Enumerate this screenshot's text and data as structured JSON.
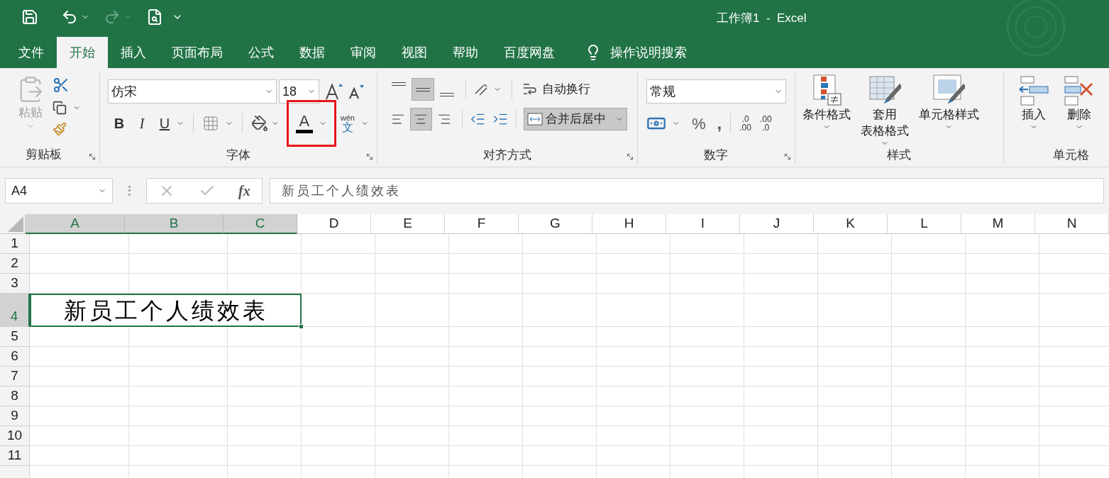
{
  "window": {
    "title": "工作簿1  -  Excel"
  },
  "quick_access": [
    {
      "kind": "save",
      "disabled": false
    },
    {
      "kind": "undo",
      "disabled": false
    },
    {
      "kind": "redo",
      "disabled": true
    },
    {
      "kind": "preview",
      "disabled": false
    },
    {
      "kind": "customize",
      "disabled": false
    }
  ],
  "tabs": [
    {
      "label": "文件",
      "selected": false
    },
    {
      "label": "开始",
      "selected": true
    },
    {
      "label": "插入",
      "selected": false
    },
    {
      "label": "页面布局",
      "selected": false
    },
    {
      "label": "公式",
      "selected": false
    },
    {
      "label": "数据",
      "selected": false
    },
    {
      "label": "审阅",
      "selected": false
    },
    {
      "label": "视图",
      "selected": false
    },
    {
      "label": "帮助",
      "selected": false
    },
    {
      "label": "百度网盘",
      "selected": false
    }
  ],
  "tell_me": "操作说明搜索",
  "clipboard": {
    "label": "剪贴板",
    "paste": "粘贴"
  },
  "font": {
    "label": "字体",
    "font_name": "仿宋",
    "font_size": "18",
    "bold": "B",
    "italic": "I",
    "underline": "U",
    "phonetic_top": "wén",
    "phonetic_bottom": "文",
    "font_color": {
      "letter": "A",
      "highlighted": true
    }
  },
  "alignment": {
    "label": "对齐方式",
    "vertical": [
      {
        "selected": false
      },
      {
        "selected": true
      },
      {
        "selected": false
      }
    ],
    "horizontal": [
      {
        "selected": false
      },
      {
        "selected": true
      },
      {
        "selected": false
      }
    ],
    "wrap_text": "自动换行",
    "merge_center": {
      "label": "合并后居中",
      "selected": true
    }
  },
  "number": {
    "label": "数字",
    "format": "常规",
    "percent": "%",
    "comma": ",",
    "decimals": [
      {
        "top": ".0",
        "bottom": ".00"
      },
      {
        "top": ".00",
        "bottom": ".0"
      }
    ]
  },
  "styles": {
    "label": "样式",
    "buttons": [
      {
        "kind": "conditional",
        "lines": [
          "条件格式"
        ]
      },
      {
        "kind": "table",
        "lines": [
          "套用",
          "表格格式"
        ]
      },
      {
        "kind": "cell",
        "lines": [
          "单元格样式"
        ]
      }
    ]
  },
  "cells": {
    "label": "单元格",
    "buttons": [
      {
        "kind": "insert",
        "label": "插入"
      },
      {
        "kind": "delete",
        "label": "删除"
      }
    ]
  },
  "formula_bar": {
    "name_box": "A4",
    "fx": "fx",
    "content": "新员工个人绩效表"
  },
  "sheet": {
    "columns": [
      {
        "label": "A",
        "selected": true
      },
      {
        "label": "B",
        "selected": true
      },
      {
        "label": "C",
        "selected": true
      },
      {
        "label": "D",
        "selected": false
      },
      {
        "label": "E",
        "selected": false
      },
      {
        "label": "F",
        "selected": false
      },
      {
        "label": "G",
        "selected": false
      },
      {
        "label": "H",
        "selected": false
      },
      {
        "label": "I",
        "selected": false
      },
      {
        "label": "J",
        "selected": false
      },
      {
        "label": "K",
        "selected": false
      },
      {
        "label": "L",
        "selected": false
      },
      {
        "label": "M",
        "selected": false
      },
      {
        "label": "N",
        "selected": false
      }
    ],
    "rows": [
      {
        "label": "1",
        "selected": false,
        "kind": "normal"
      },
      {
        "label": "2",
        "selected": false,
        "kind": "normal"
      },
      {
        "label": "3",
        "selected": false,
        "kind": "normal"
      },
      {
        "label": "4",
        "selected": true,
        "kind": "merged",
        "value": "新员工个人绩效表"
      },
      {
        "label": "5",
        "selected": false,
        "kind": "normal"
      },
      {
        "label": "6",
        "selected": false,
        "kind": "normal"
      },
      {
        "label": "7",
        "selected": false,
        "kind": "normal"
      },
      {
        "label": "8",
        "selected": false,
        "kind": "normal"
      },
      {
        "label": "9",
        "selected": false,
        "kind": "normal"
      },
      {
        "label": "10",
        "selected": false,
        "kind": "normal"
      },
      {
        "label": "11",
        "selected": false,
        "kind": "normal"
      }
    ]
  }
}
